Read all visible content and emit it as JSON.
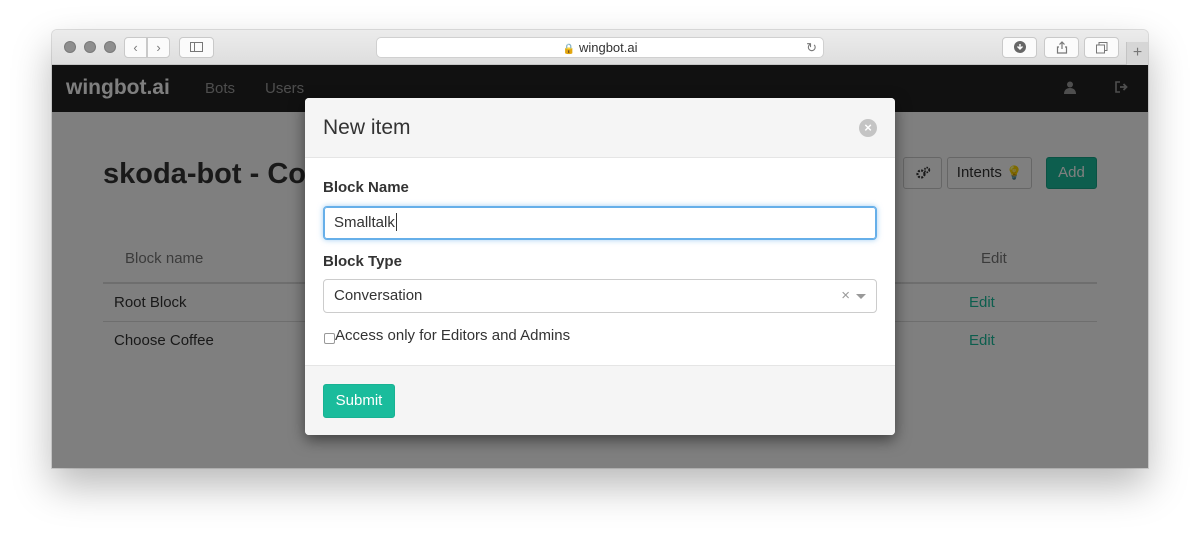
{
  "browser": {
    "url": "wingbot.ai",
    "back_icon": "chevron-left-icon",
    "forward_icon": "chevron-right-icon",
    "sidebar_icon": "sidebar-icon",
    "reload_icon": "reload-icon",
    "download_icon": "download-icon",
    "share_icon": "share-icon",
    "tabs_icon": "tabs-icon",
    "new_tab_label": "+"
  },
  "navbar": {
    "brand": "wingbot.ai",
    "links": [
      "Bots",
      "Users"
    ],
    "user_icon": "user-icon",
    "logout_icon": "logout-icon"
  },
  "page": {
    "title": "skoda-bot - Co",
    "toolbar": {
      "settings_icon": "cogs-icon",
      "intents_label": "Intents",
      "intents_icon": "lightbulb-icon",
      "add_label": "Add"
    },
    "table": {
      "headers": [
        "Block name",
        "Edit"
      ],
      "rows": [
        {
          "name": "Root Block",
          "edit": "Edit"
        },
        {
          "name": "Choose Coffee",
          "edit": "Edit"
        }
      ]
    }
  },
  "modal": {
    "title": "New item",
    "close_icon": "close-circle-icon",
    "block_name_label": "Block Name",
    "block_name_value": "Smalltalk",
    "block_type_label": "Block Type",
    "block_type_value": "Conversation",
    "clear_symbol": "×",
    "checkbox_label": "Access only for Editors and Admins",
    "checkbox_checked": false,
    "submit_label": "Submit"
  },
  "colors": {
    "accent": "#1abc9c",
    "navbar_bg": "#222222",
    "focus_border": "#66afe9"
  }
}
